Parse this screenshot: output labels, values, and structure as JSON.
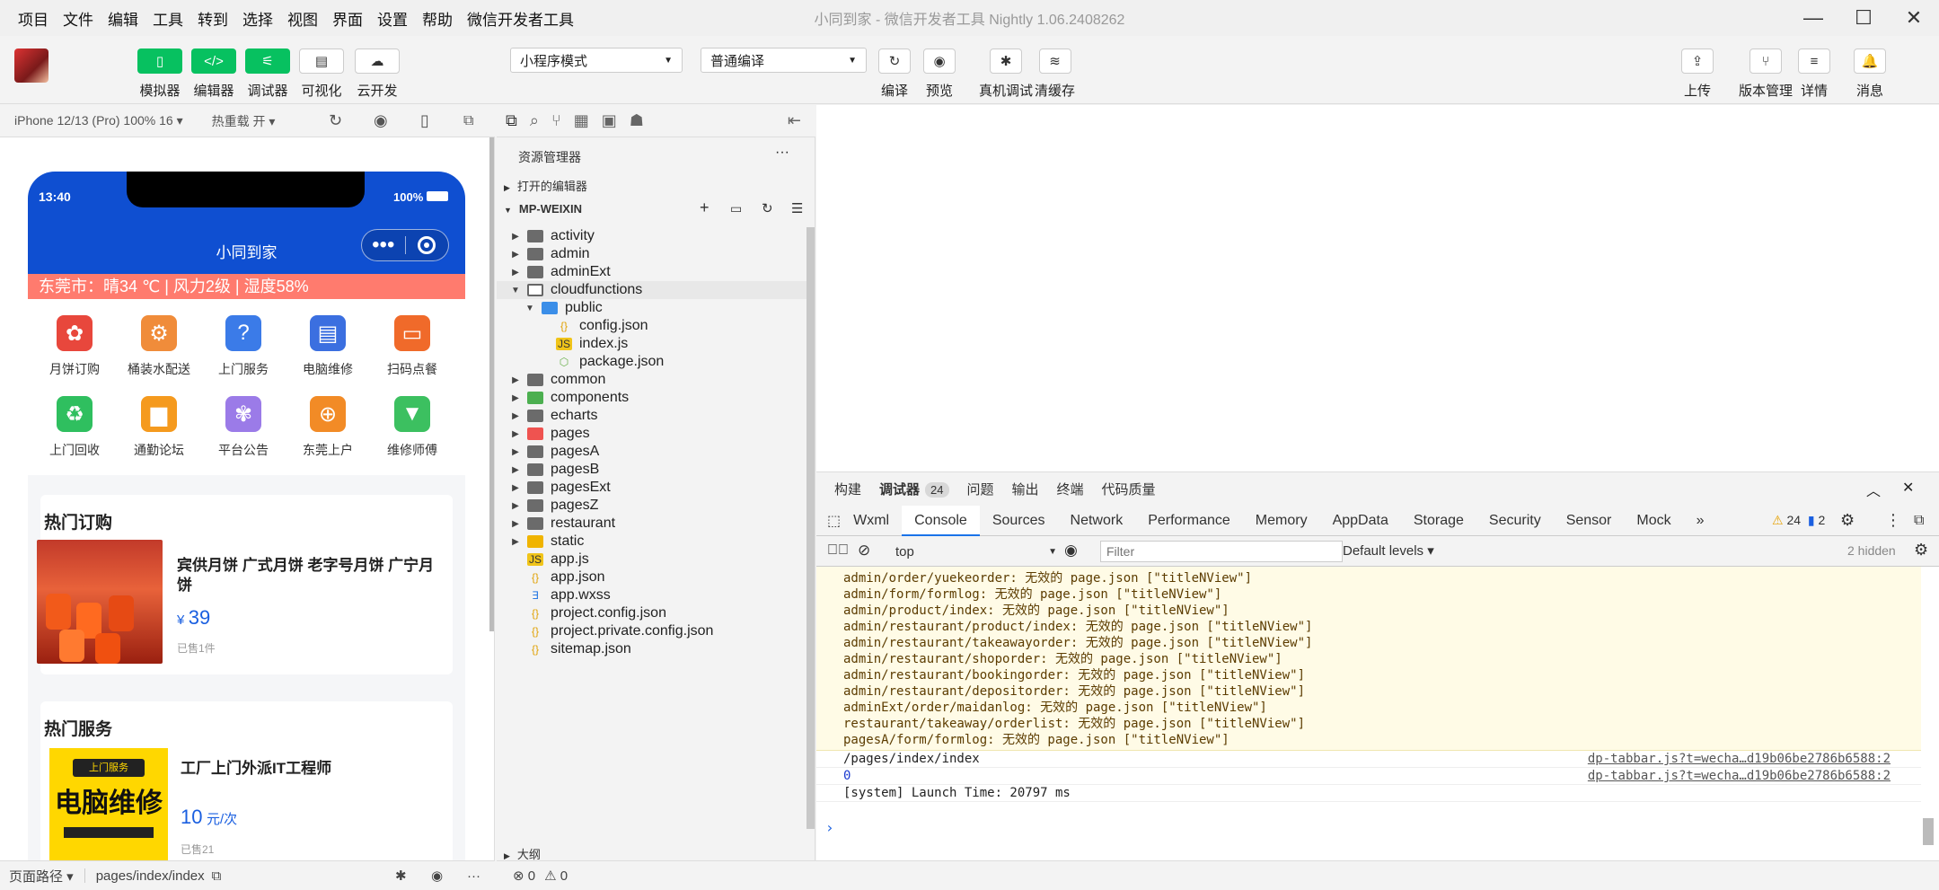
{
  "menu": [
    "项目",
    "文件",
    "编辑",
    "工具",
    "转到",
    "选择",
    "视图",
    "界面",
    "设置",
    "帮助",
    "微信开发者工具"
  ],
  "window_title": "小同到家 - 微信开发者工具 Nightly 1.06.2408262",
  "window_controls": {
    "minimize": "—",
    "maximize": "☐",
    "close": "✕"
  },
  "toolbar": {
    "left_buttons": [
      {
        "label": "模拟器",
        "icon": "phone-icon",
        "glyph": "▯"
      },
      {
        "label": "编辑器",
        "icon": "code-icon",
        "glyph": "</>"
      },
      {
        "label": "调试器",
        "icon": "sliders-icon",
        "glyph": "⚟"
      },
      {
        "label": "可视化",
        "icon": "layout-icon",
        "glyph": "▤"
      },
      {
        "label": "云开发",
        "icon": "cloud-icon",
        "glyph": "☁"
      }
    ],
    "mode_select": "小程序模式",
    "compile_select": "普通编译",
    "center_buttons": [
      {
        "label": "编译",
        "icon": "refresh-icon",
        "glyph": "↻"
      },
      {
        "label": "预览",
        "icon": "eye-icon",
        "glyph": "◉"
      },
      {
        "label": "真机调试",
        "icon": "bug-icon",
        "glyph": "✱"
      },
      {
        "label": "清缓存",
        "icon": "layers-icon",
        "glyph": "≋"
      }
    ],
    "right_buttons": [
      {
        "label": "上传",
        "icon": "upload-icon",
        "glyph": "⇪"
      },
      {
        "label": "版本管理",
        "icon": "branch-icon",
        "glyph": "⑂"
      },
      {
        "label": "详情",
        "icon": "menu-icon",
        "glyph": "≡"
      },
      {
        "label": "消息",
        "icon": "bell-icon",
        "glyph": "🔔"
      }
    ]
  },
  "simulator": {
    "device": "iPhone 12/13 (Pro) 100% 16 ▾",
    "hot_reload": "热重载 开 ▾",
    "time": "13:40",
    "battery": "100%",
    "page_title": "小同到家",
    "weather": "东莞市：晴34 ℃ | 风力2级 | 湿度58%",
    "grid": [
      {
        "label": "月饼订购",
        "color": "#e8473c",
        "glyph": "✿"
      },
      {
        "label": "桶装水配送",
        "color": "#f08c3a",
        "glyph": "⚙"
      },
      {
        "label": "上门服务",
        "color": "#3b7be8",
        "glyph": "?"
      },
      {
        "label": "电脑维修",
        "color": "#3b6fe0",
        "glyph": "▤"
      },
      {
        "label": "扫码点餐",
        "color": "#f06a2a",
        "glyph": "▭"
      },
      {
        "label": "上门回收",
        "color": "#2fbf5f",
        "glyph": "♻"
      },
      {
        "label": "通勤论坛",
        "color": "#f59a1e",
        "glyph": "▆"
      },
      {
        "label": "平台公告",
        "color": "#9b7be8",
        "glyph": "✾"
      },
      {
        "label": "东莞上户",
        "color": "#f28b26",
        "glyph": "⊕"
      },
      {
        "label": "维修师傅",
        "color": "#3cc060",
        "glyph": "▼"
      }
    ],
    "hot_orders": {
      "title": "热门订购",
      "product": "宾供月饼 广式月饼 老字号月饼 广宁月饼",
      "price_symbol": "¥",
      "price": "39",
      "sold": "已售1件"
    },
    "hot_services": {
      "title": "热门服务",
      "service": "工厂上门外派IT工程师",
      "price": "10",
      "unit": "元/次",
      "sold": "已售21",
      "img_banner": "上门服务",
      "img_text": "电脑维修"
    }
  },
  "explorer": {
    "title": "资源管理器",
    "open_editors": "打开的编辑器",
    "project": "MP-WEIXIN",
    "outline": "大纲",
    "tree": [
      {
        "name": "activity",
        "type": "folder",
        "depth": 0
      },
      {
        "name": "admin",
        "type": "folder",
        "depth": 0
      },
      {
        "name": "adminExt",
        "type": "folder",
        "depth": 0
      },
      {
        "name": "cloudfunctions",
        "type": "folder-open",
        "depth": 0
      },
      {
        "name": "public",
        "type": "folder-open-blue",
        "depth": 1
      },
      {
        "name": "config.json",
        "type": "json",
        "depth": 2
      },
      {
        "name": "index.js",
        "type": "js",
        "depth": 2
      },
      {
        "name": "package.json",
        "type": "pkg",
        "depth": 2
      },
      {
        "name": "common",
        "type": "folder",
        "depth": 0
      },
      {
        "name": "components",
        "type": "folder-green",
        "depth": 0
      },
      {
        "name": "echarts",
        "type": "folder",
        "depth": 0
      },
      {
        "name": "pages",
        "type": "folder-red",
        "depth": 0
      },
      {
        "name": "pagesA",
        "type": "folder",
        "depth": 0
      },
      {
        "name": "pagesB",
        "type": "folder",
        "depth": 0
      },
      {
        "name": "pagesExt",
        "type": "folder",
        "depth": 0
      },
      {
        "name": "pagesZ",
        "type": "folder",
        "depth": 0
      },
      {
        "name": "restaurant",
        "type": "folder",
        "depth": 0
      },
      {
        "name": "static",
        "type": "folder-yellow",
        "depth": 0
      },
      {
        "name": "app.js",
        "type": "js",
        "depth": 0
      },
      {
        "name": "app.json",
        "type": "json",
        "depth": 0
      },
      {
        "name": "app.wxss",
        "type": "wxss",
        "depth": 0
      },
      {
        "name": "project.config.json",
        "type": "json",
        "depth": 0
      },
      {
        "name": "project.private.config.json",
        "type": "json",
        "depth": 0
      },
      {
        "name": "sitemap.json",
        "type": "json",
        "depth": 0
      }
    ]
  },
  "devtools": {
    "top_tabs": [
      "构建",
      "调试器",
      "问题",
      "输出",
      "终端",
      "代码质量"
    ],
    "debugger_badge": "24",
    "panel_tabs": [
      "Wxml",
      "Console",
      "Sources",
      "Network",
      "Performance",
      "Memory",
      "AppData",
      "Storage",
      "Security",
      "Sensor",
      "Mock"
    ],
    "warn_count": "24",
    "error_count": "2",
    "context": "top",
    "filter_placeholder": "Filter",
    "levels": "Default levels ▾",
    "hidden": "2 hidden",
    "warnings": [
      "admin/order/yuekeorder: 无效的 page.json [\"titleNView\"]",
      "admin/form/formlog: 无效的 page.json [\"titleNView\"]",
      "admin/product/index: 无效的 page.json [\"titleNView\"]",
      "admin/restaurant/product/index: 无效的 page.json [\"titleNView\"]",
      "admin/restaurant/takeawayorder: 无效的 page.json [\"titleNView\"]",
      "admin/restaurant/shoporder: 无效的 page.json [\"titleNView\"]",
      "admin/restaurant/bookingorder: 无效的 page.json [\"titleNView\"]",
      "admin/restaurant/depositorder: 无效的 page.json [\"titleNView\"]",
      "adminExt/order/maidanlog: 无效的 page.json [\"titleNView\"]",
      "restaurant/takeaway/orderlist: 无效的 page.json [\"titleNView\"]",
      "pagesA/form/formlog: 无效的 page.json [\"titleNView\"]"
    ],
    "logs": [
      {
        "text": "/pages/index/index",
        "source": "dp-tabbar.js?t=wecha…d19b06be2786b6588:2"
      },
      {
        "text": "0",
        "source": "dp-tabbar.js?t=wecha…d19b06be2786b6588:2"
      },
      {
        "text": "[system] Launch Time: 20797 ms",
        "source": ""
      }
    ],
    "prompt": "›"
  },
  "status": {
    "page_path_label": "页面路径 ▾",
    "page_path": "pages/index/index",
    "errors": "⊗ 0",
    "warnings": "⚠ 0"
  }
}
